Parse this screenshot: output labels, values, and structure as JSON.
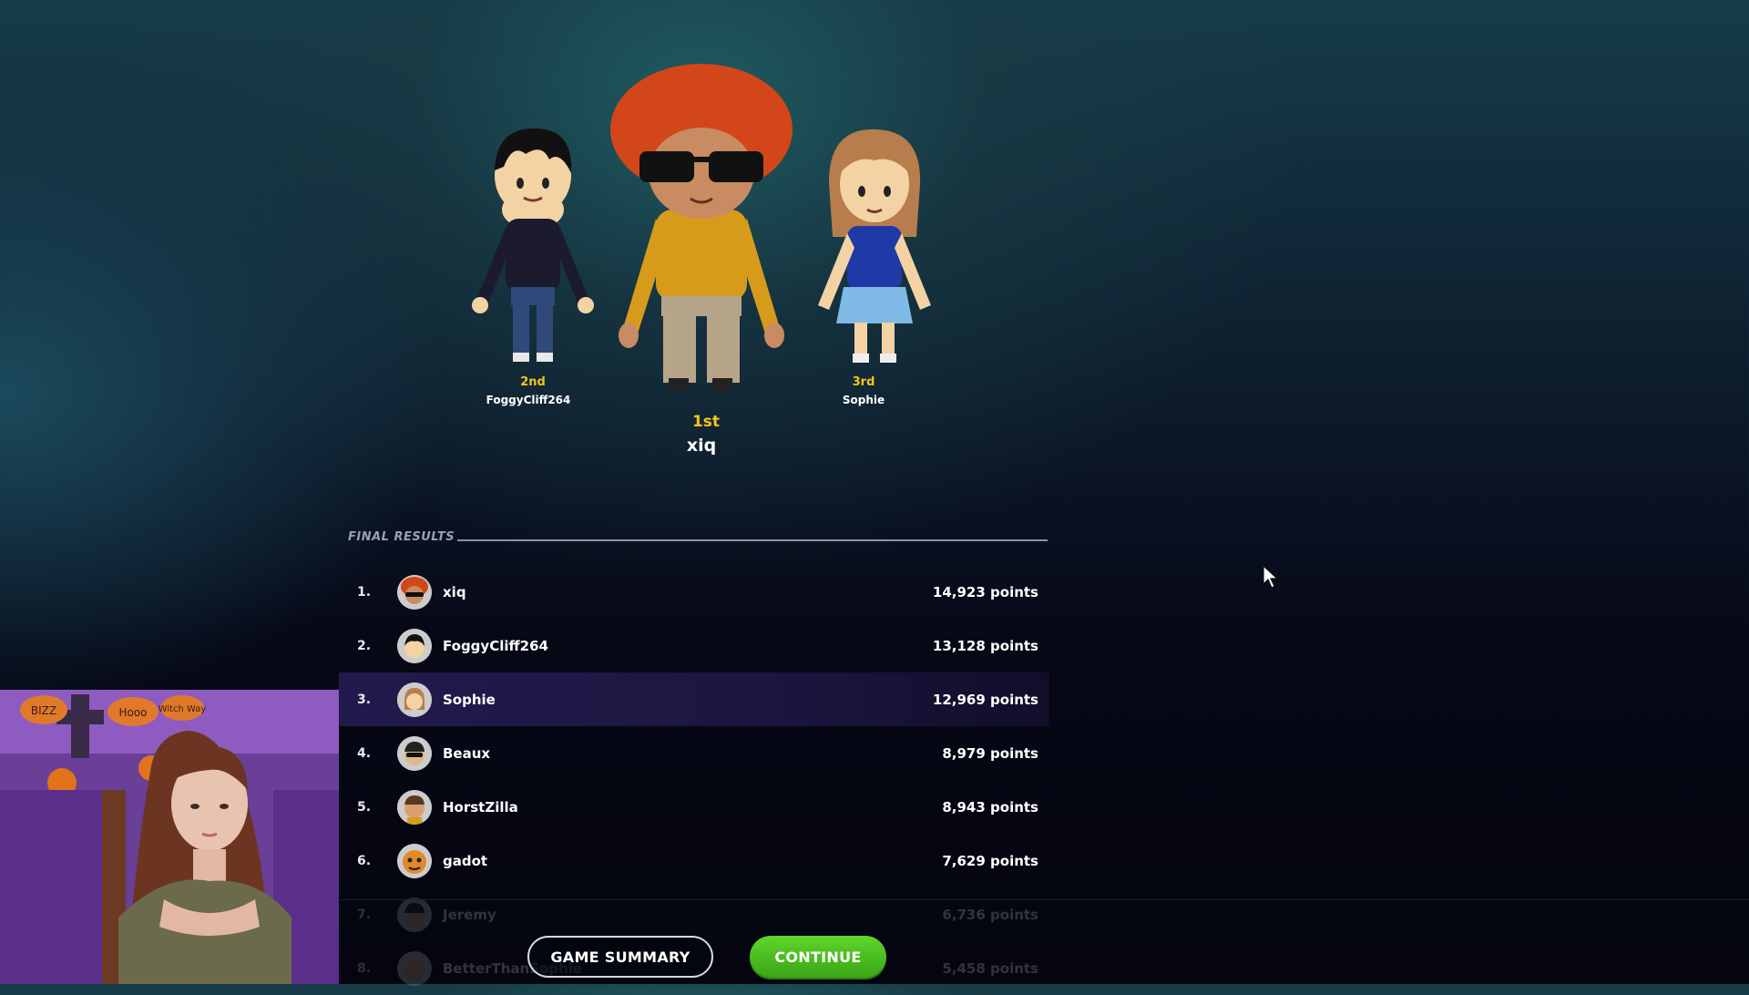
{
  "podium": {
    "first": {
      "place": "1st",
      "name": "xiq"
    },
    "second": {
      "place": "2nd",
      "name": "FoggyCliff264"
    },
    "third": {
      "place": "3rd",
      "name": "Sophie"
    }
  },
  "results": {
    "title": "FINAL RESULTS",
    "rows": [
      {
        "rank": "1.",
        "name": "xiq",
        "points": "14,923 points"
      },
      {
        "rank": "2.",
        "name": "FoggyCliff264",
        "points": "13,128 points"
      },
      {
        "rank": "3.",
        "name": "Sophie",
        "points": "12,969 points"
      },
      {
        "rank": "4.",
        "name": "Beaux",
        "points": "8,979 points"
      },
      {
        "rank": "5.",
        "name": "HorstZilla",
        "points": "8,943 points"
      },
      {
        "rank": "6.",
        "name": "gadot",
        "points": "7,629 points"
      },
      {
        "rank": "7.",
        "name": "Jeremy",
        "points": "6,736 points"
      },
      {
        "rank": "8.",
        "name": "BetterThanSophie",
        "points": "5,458 points"
      }
    ]
  },
  "buttons": {
    "summary": "GAME SUMMARY",
    "continue": "CONTINUE"
  },
  "colors": {
    "gold": "#f5c518",
    "continue_green": "#4cc21f",
    "highlight_row": "#221a4d"
  },
  "webcam": {
    "signs": [
      "BIZZ",
      "Hooo",
      "Witch Way"
    ]
  }
}
